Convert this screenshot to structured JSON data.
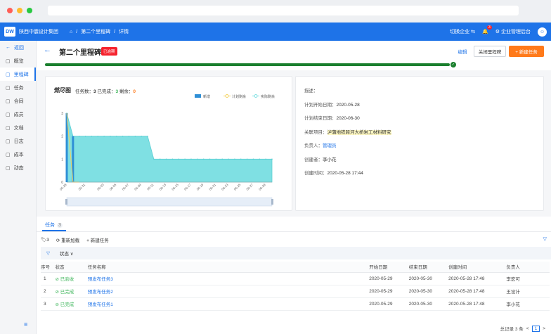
{
  "chrome": {
    "dot_colors": [
      "#ff5f57",
      "#febc2e",
      "#28c840"
    ]
  },
  "topbar": {
    "logo": "DW",
    "company": "陕西中震设计集团",
    "crumbs": [
      "第二个里程碑",
      "详情"
    ],
    "switch": "切换企业",
    "bell_count": "3",
    "admin": "企业管理后台"
  },
  "sidebar": [
    {
      "icon": "back-arrow-icon",
      "label": "返回"
    },
    {
      "icon": "overview-icon",
      "label": "概览"
    },
    {
      "icon": "milestone-icon",
      "label": "里程碑"
    },
    {
      "icon": "task-icon",
      "label": "任务"
    },
    {
      "icon": "contract-icon",
      "label": "合同"
    },
    {
      "icon": "member-icon",
      "label": "成员"
    },
    {
      "icon": "document-icon",
      "label": "文档"
    },
    {
      "icon": "log-icon",
      "label": "日志"
    },
    {
      "icon": "cost-icon",
      "label": "成本"
    },
    {
      "icon": "activity-icon",
      "label": "动态"
    }
  ],
  "header": {
    "title": "第二个里程碑",
    "status": "已逾期",
    "edit": "编辑",
    "close": "关闭里程碑",
    "new_task": "+ 新建任务"
  },
  "burndown": {
    "title": "燃尽图",
    "count_label": "任务数：",
    "total": "3",
    "done_label": "已完成：",
    "done": "3",
    "left_label": "剩余：",
    "left": "0"
  },
  "chart_data": {
    "type": "area",
    "title": "燃尽图",
    "legend": [
      "新增",
      "计划剩余",
      "实际剩余"
    ],
    "legend_position": "top-right",
    "x": [
      "05-28",
      "05-29",
      "05-30",
      "05-31",
      "06-01",
      "06-02",
      "06-03",
      "06-04",
      "06-05",
      "06-06",
      "06-07",
      "06-08",
      "06-09",
      "06-10",
      "06-11",
      "06-12",
      "06-13",
      "06-14",
      "06-15",
      "06-16",
      "06-17",
      "06-18",
      "06-19",
      "06-20",
      "06-21",
      "06-22",
      "06-23",
      "06-24",
      "06-25",
      "06-26",
      "06-27",
      "06-28",
      "06-29",
      "06-30"
    ],
    "x_tick_labels": [
      "05-28",
      "05-31",
      "06-03",
      "06-05",
      "06-07",
      "06-09",
      "06-11",
      "06-13",
      "06-15",
      "06-17",
      "06-19",
      "06-21",
      "06-23",
      "06-25",
      "06-27",
      "06-29"
    ],
    "ylim": [
      0,
      3
    ],
    "yticks": [
      "0",
      "1",
      "2",
      "3"
    ],
    "series": [
      {
        "name": "新增",
        "type": "bar",
        "values": [
          3,
          2,
          0,
          0,
          0,
          0,
          0,
          0,
          0,
          0,
          0,
          0,
          0,
          0,
          0,
          0,
          0,
          0,
          0,
          0,
          0,
          0,
          0,
          0,
          0,
          0,
          0,
          0,
          0,
          0,
          0,
          0,
          0,
          0
        ]
      },
      {
        "name": "计划剩余",
        "values": [
          3,
          0,
          0,
          0,
          0,
          0,
          0,
          0,
          0,
          0,
          0,
          0,
          0,
          0,
          0,
          0,
          0,
          0,
          0,
          0,
          0,
          0,
          0,
          0,
          0,
          0,
          0,
          0,
          0,
          0,
          0,
          0,
          0,
          0
        ]
      },
      {
        "name": "实际剩余",
        "values": [
          3,
          2,
          2,
          2,
          2,
          2,
          2,
          2,
          2,
          2,
          2,
          2,
          2,
          2,
          1,
          1,
          1,
          1,
          1,
          1,
          1,
          1,
          1,
          1,
          1,
          1,
          1,
          1,
          1,
          1,
          1,
          1,
          1,
          1
        ]
      }
    ],
    "colors": {
      "new": "#2f8fd6",
      "plan": "#f4d35e",
      "actual": "#7fe0e3"
    }
  },
  "info": [
    {
      "label": "描述：",
      "value": ""
    },
    {
      "label": "计划开始日期：",
      "value": "2020-05-28"
    },
    {
      "label": "计划结束日期：",
      "value": "2020-06-30"
    },
    {
      "label": "关联项目：",
      "value": "泸蒲地铁跨河大桥岩工材料研究"
    },
    {
      "label": "负责人：",
      "value": "管理员"
    },
    {
      "label": "创建者：",
      "value": "李小花"
    },
    {
      "label": "创建时间：",
      "value": "2020-05-28 17:44"
    }
  ],
  "tasks": {
    "tab": "任务",
    "tab_count": "3",
    "tag_count": "3",
    "reload": "重新加载",
    "new": "+ 新建任务",
    "filter": "状态",
    "columns": [
      "序号",
      "状态",
      "任务名称",
      "开始日期",
      "结束日期",
      "创建时间",
      "负责人"
    ],
    "rows": [
      [
        "1",
        "已验收",
        "预发布任务3",
        "2020-05-29",
        "2020-05-30",
        "2020-05-28 17:48",
        "李宏可"
      ],
      [
        "2",
        "已完成",
        "预发布任务2",
        "2020-05-29",
        "2020-05-30",
        "2020-05-28 17:48",
        "王设计"
      ],
      [
        "3",
        "已完成",
        "预发布任务1",
        "2020-05-29",
        "2020-05-30",
        "2020-05-28 17:48",
        "李小花"
      ]
    ],
    "total": "总记录 3 条",
    "page": "1"
  }
}
